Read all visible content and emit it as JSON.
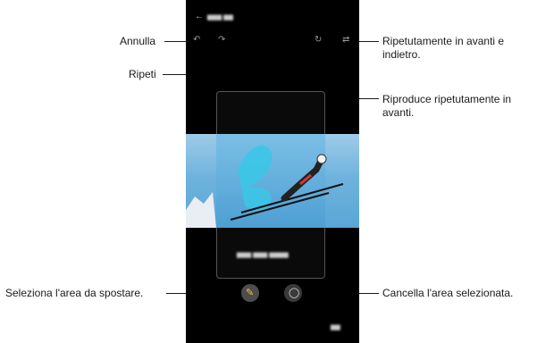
{
  "callouts": {
    "undo": "Annulla",
    "redo": "Ripeti",
    "bounce": "Ripetutamente in avanti e indietro.",
    "loop": "Riproduce ripetutamente in avanti.",
    "select_area": "Seleziona l'area da spostare.",
    "erase_area": "Cancella l'area selezionata."
  },
  "icons": {
    "back": "arrow-left-icon",
    "undo": "undo-icon",
    "redo": "redo-icon",
    "loop": "loop-forward-icon",
    "bounce": "bounce-icon",
    "select": "pencil-icon",
    "erase": "eraser-icon"
  },
  "colors": {
    "screen_bg": "#000000",
    "sky": "#5aa6d6",
    "button_bg": "#4d4d4d",
    "callout_text": "#1a1a1a"
  }
}
